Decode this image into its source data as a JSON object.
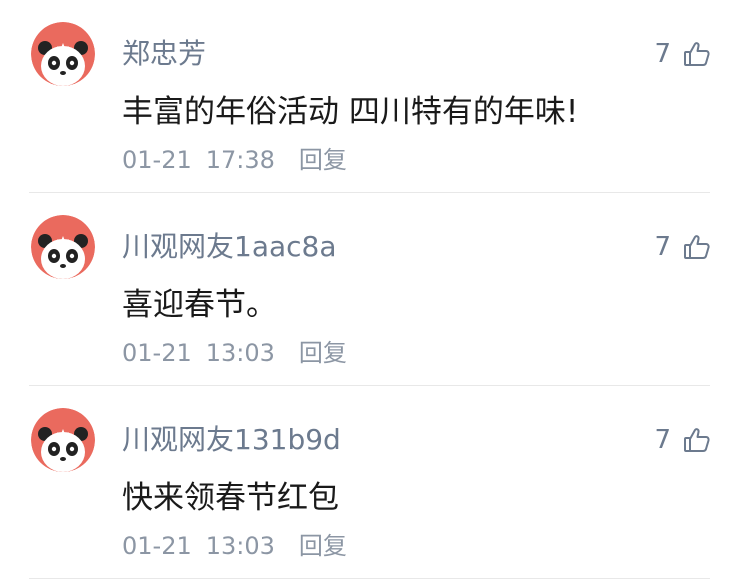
{
  "theme": {
    "avatar_bg": "#ea6a5e",
    "username_color": "#6c7a8e",
    "text_color": "#1a1a1a",
    "meta_color": "#8c96a4"
  },
  "comments": [
    {
      "avatar_icon": "panda-avatar-icon",
      "username": "郑忠芳",
      "like_count": "7",
      "like_icon": "thumbs-up-icon",
      "text": "丰富的年俗活动 四川特有的年味!",
      "date": "01-21",
      "time": "17:38",
      "reply_label": "回复"
    },
    {
      "avatar_icon": "panda-avatar-icon",
      "username": "川观网友1aac8a",
      "like_count": "7",
      "like_icon": "thumbs-up-icon",
      "text": "喜迎春节。",
      "date": "01-21",
      "time": "13:03",
      "reply_label": "回复"
    },
    {
      "avatar_icon": "panda-avatar-icon",
      "username": "川观网友131b9d",
      "like_count": "7",
      "like_icon": "thumbs-up-icon",
      "text": "快来领春节红包",
      "date": "01-21",
      "time": "13:03",
      "reply_label": "回复"
    }
  ]
}
